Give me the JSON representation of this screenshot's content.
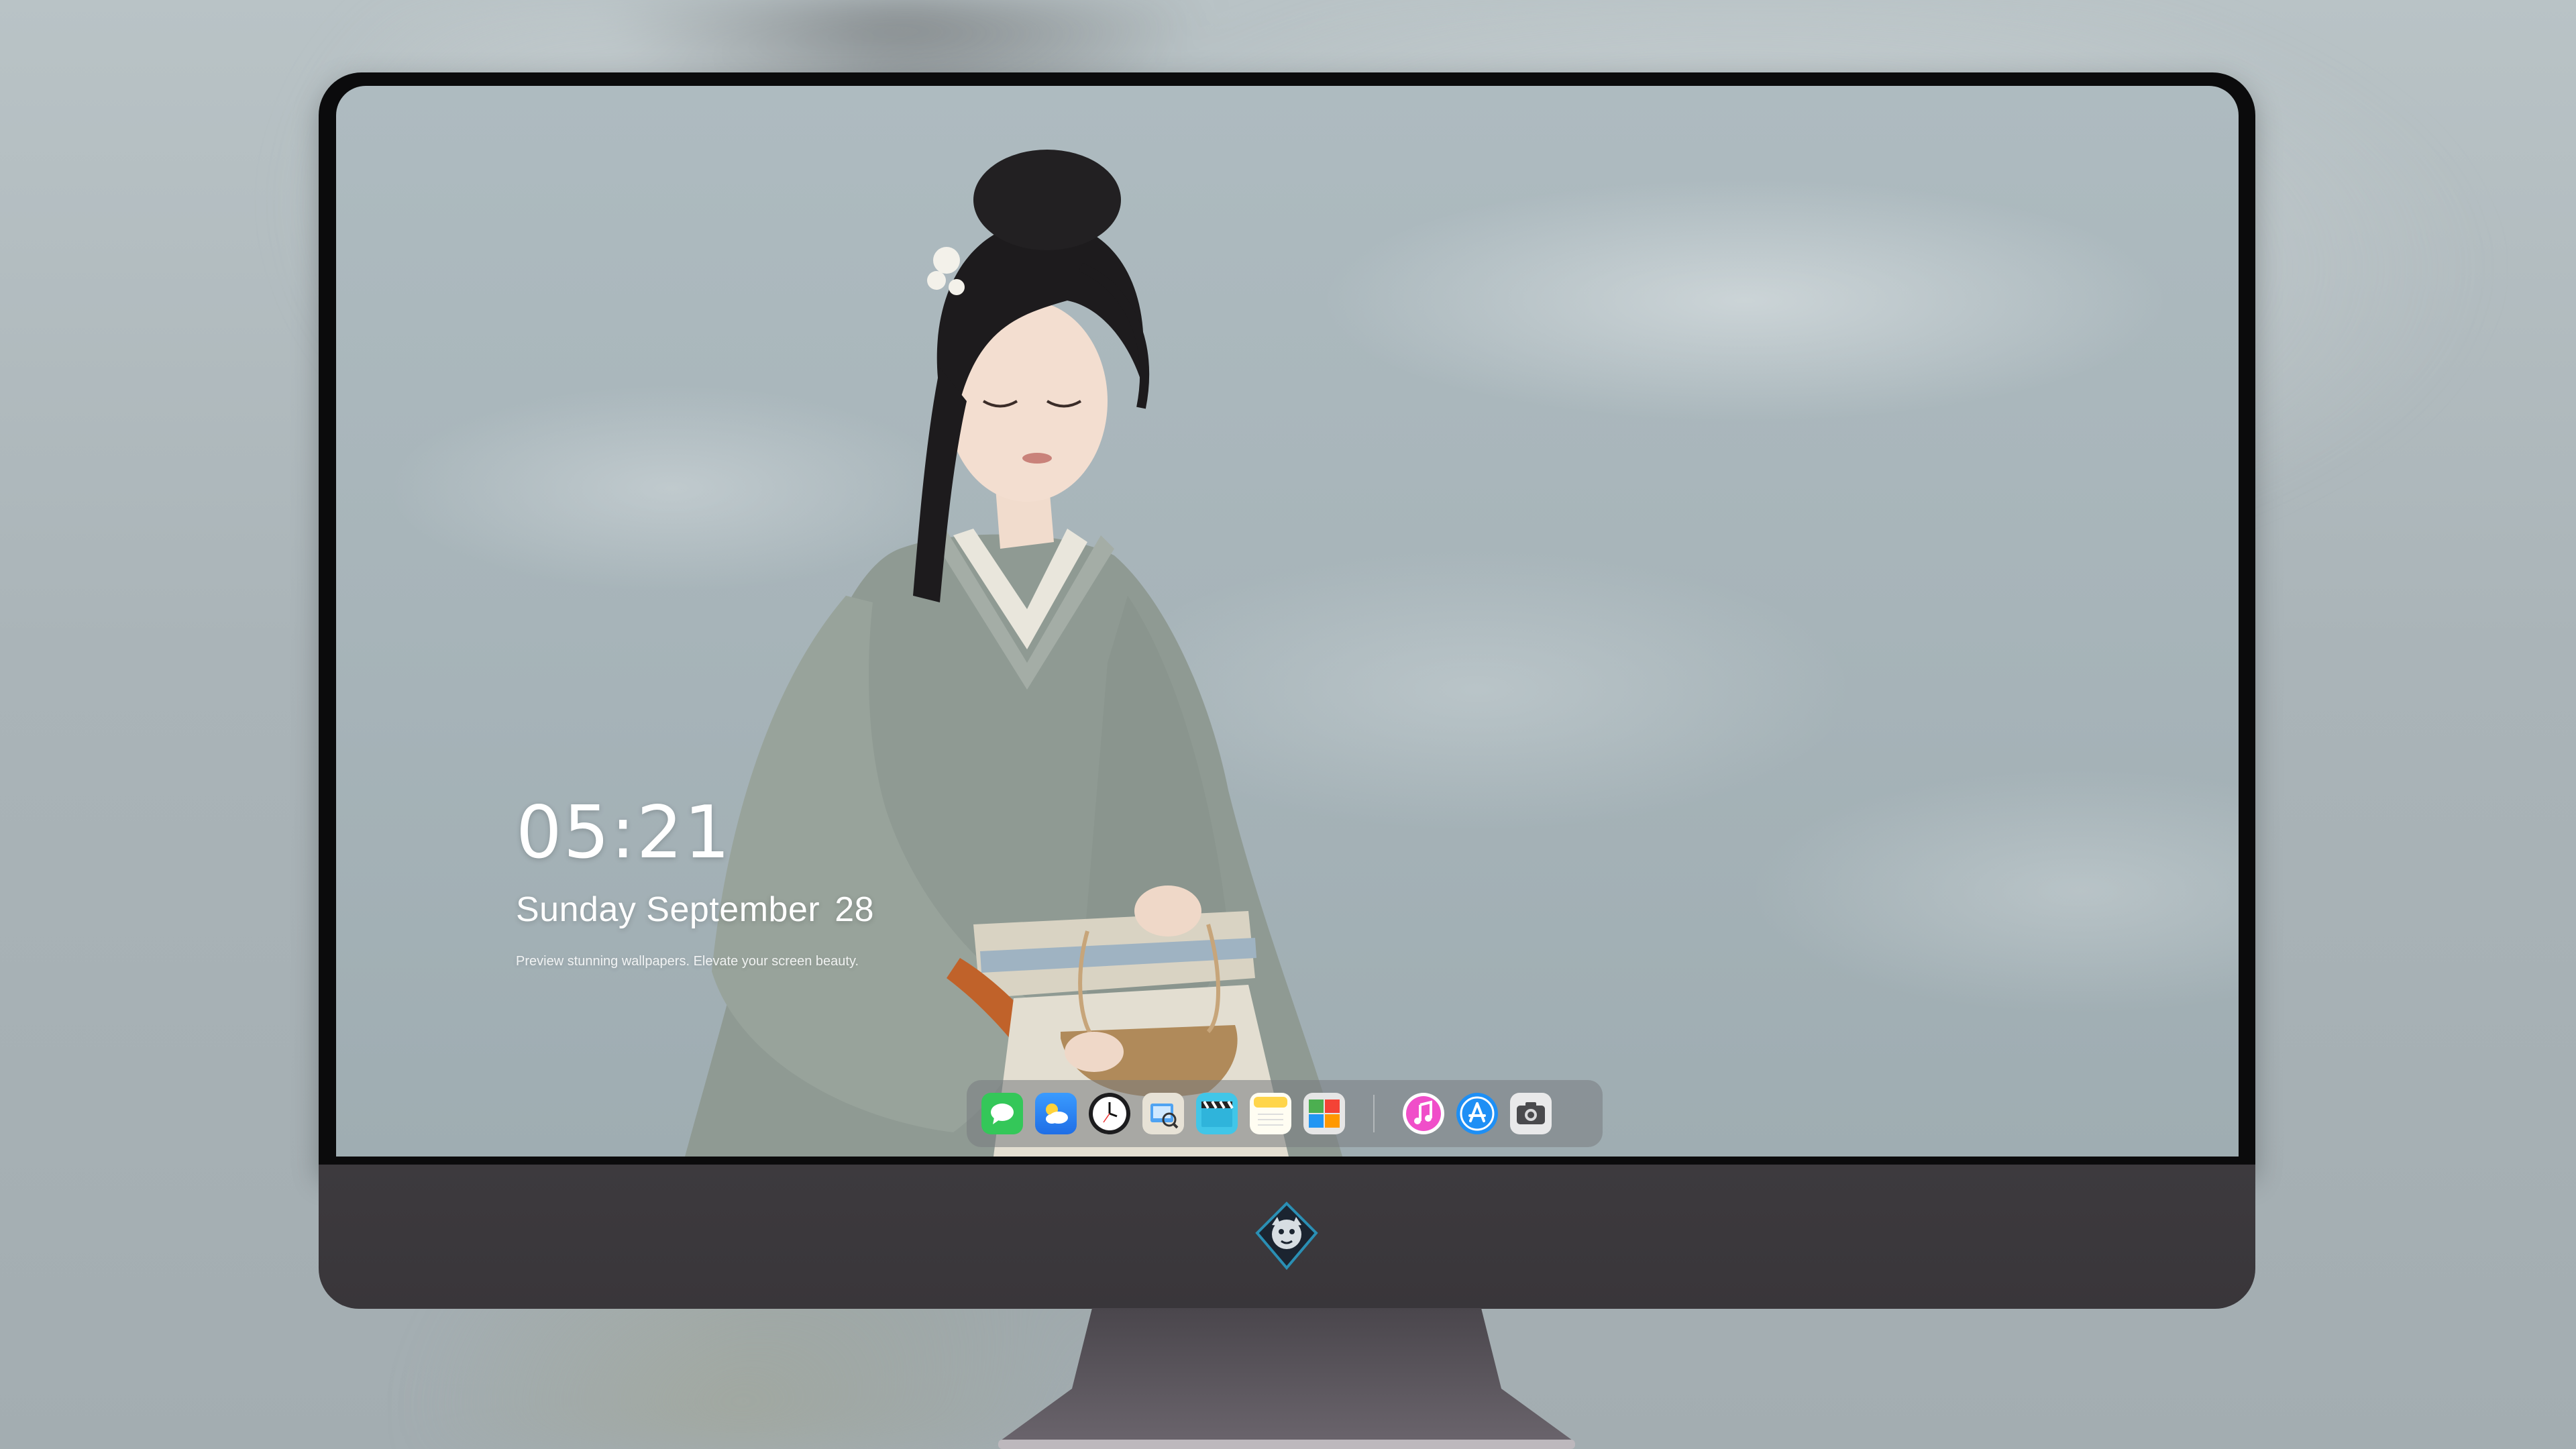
{
  "lockscreen": {
    "time": "05:21",
    "date_weekday_month": "Sunday September",
    "date_day": "28",
    "tagline": "Preview stunning wallpapers. Elevate your screen beauty."
  },
  "dock": {
    "apps": [
      {
        "name": "Messages",
        "icon": "messages-icon",
        "color": "#34c759"
      },
      {
        "name": "Weather",
        "icon": "weather-icon",
        "color": "#2f8ff7"
      },
      {
        "name": "Clock",
        "icon": "clock-icon",
        "color": "#1c1c1e"
      },
      {
        "name": "Preview",
        "icon": "preview-icon",
        "color": "#e7e2d6"
      },
      {
        "name": "Clips",
        "icon": "clapperboard-icon",
        "color": "#41c6e8"
      },
      {
        "name": "Notes",
        "icon": "notes-icon",
        "color": "#ffd54a"
      },
      {
        "name": "Photo Booth",
        "icon": "photo-booth-icon",
        "color": "#e6e6e6"
      },
      {
        "name": "Music",
        "icon": "music-icon",
        "color": "#f04ec9"
      },
      {
        "name": "App Store",
        "icon": "app-store-icon",
        "color": "#1e8ff5"
      },
      {
        "name": "Camera",
        "icon": "camera-icon",
        "color": "#6b6b6e"
      }
    ]
  },
  "colors": {
    "bezel": "#0b0b0c",
    "chin": "#3d3a3e",
    "dock_bg": "rgba(120,124,128,0.55)",
    "wallpaper_sky": "#a7b4b9"
  }
}
